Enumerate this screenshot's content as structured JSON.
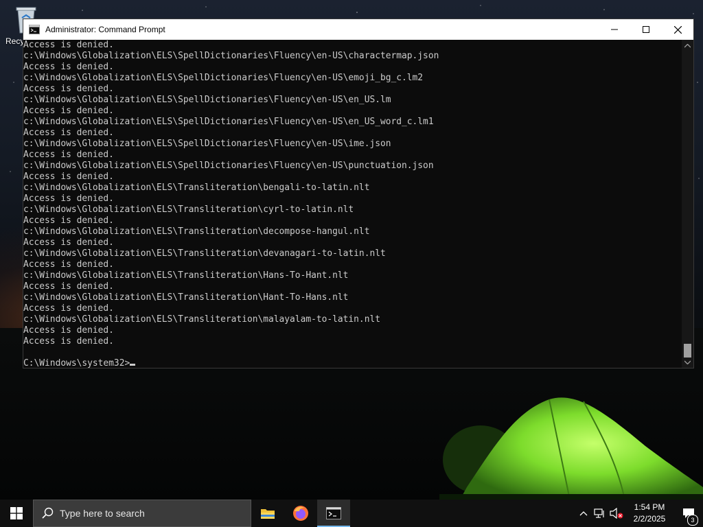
{
  "desktop": {
    "recycle_bin_label": "Recycle Bin"
  },
  "window": {
    "title": "Administrator: Command Prompt",
    "icon": "cmd-icon",
    "controls": [
      "minimize-icon",
      "maximize-icon",
      "close-icon"
    ]
  },
  "console": {
    "lines": [
      "Access is denied.",
      "c:\\Windows\\Globalization\\ELS\\SpellDictionaries\\Fluency\\en-US\\charactermap.json",
      "Access is denied.",
      "c:\\Windows\\Globalization\\ELS\\SpellDictionaries\\Fluency\\en-US\\emoji_bg_c.lm2",
      "Access is denied.",
      "c:\\Windows\\Globalization\\ELS\\SpellDictionaries\\Fluency\\en-US\\en_US.lm",
      "Access is denied.",
      "c:\\Windows\\Globalization\\ELS\\SpellDictionaries\\Fluency\\en-US\\en_US_word_c.lm1",
      "Access is denied.",
      "c:\\Windows\\Globalization\\ELS\\SpellDictionaries\\Fluency\\en-US\\ime.json",
      "Access is denied.",
      "c:\\Windows\\Globalization\\ELS\\SpellDictionaries\\Fluency\\en-US\\punctuation.json",
      "Access is denied.",
      "c:\\Windows\\Globalization\\ELS\\Transliteration\\bengali-to-latin.nlt",
      "Access is denied.",
      "c:\\Windows\\Globalization\\ELS\\Transliteration\\cyrl-to-latin.nlt",
      "Access is denied.",
      "c:\\Windows\\Globalization\\ELS\\Transliteration\\decompose-hangul.nlt",
      "Access is denied.",
      "c:\\Windows\\Globalization\\ELS\\Transliteration\\devanagari-to-latin.nlt",
      "Access is denied.",
      "c:\\Windows\\Globalization\\ELS\\Transliteration\\Hans-To-Hant.nlt",
      "Access is denied.",
      "c:\\Windows\\Globalization\\ELS\\Transliteration\\Hant-To-Hans.nlt",
      "Access is denied.",
      "c:\\Windows\\Globalization\\ELS\\Transliteration\\malayalam-to-latin.nlt",
      "Access is denied.",
      "Access is denied.",
      ""
    ],
    "prompt": "C:\\Windows\\system32>"
  },
  "taskbar": {
    "search_placeholder": "Type here to search",
    "apps": [
      {
        "name": "file-explorer-icon"
      },
      {
        "name": "firefox-icon"
      },
      {
        "name": "cmd-icon",
        "active": true
      }
    ],
    "tray_icons": [
      "chevron-up-icon",
      "network-icon",
      "volume-muted-icon"
    ],
    "time": "1:54 PM",
    "date": "2/2/2025",
    "notification_count": "3"
  },
  "colors": {
    "console_bg": "#0c0c0c",
    "console_text": "#cccccc",
    "taskbar_bg": "#101010",
    "active_indicator": "#76b9ed",
    "tent_green": "#7ddc2c"
  }
}
